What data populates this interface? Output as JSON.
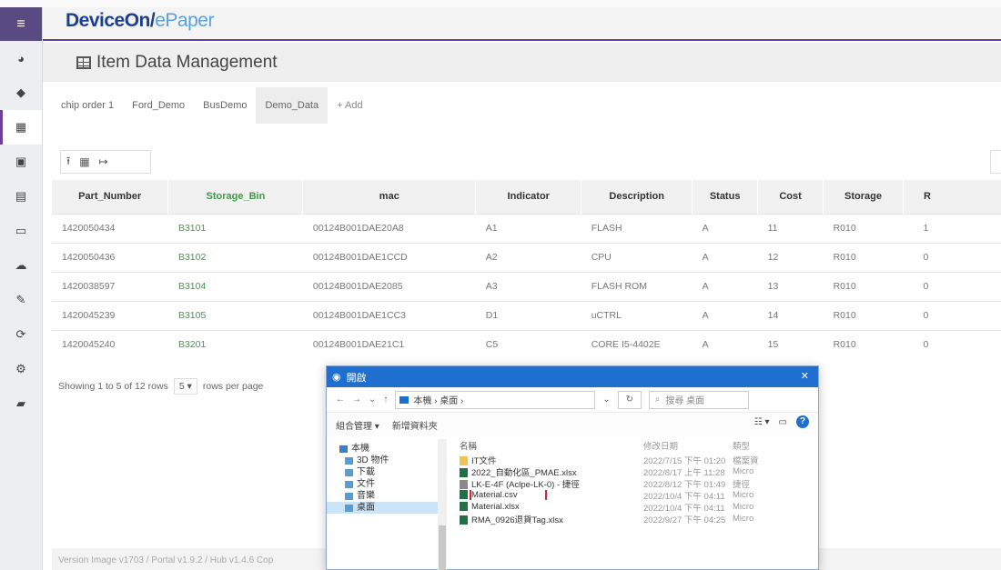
{
  "app": {
    "brand_main": "DeviceOn/",
    "brand_accent": "ePaper",
    "brand_color": "#1d3f8f",
    "accent_color": "#6a3f95"
  },
  "sidebar": {
    "items": [
      {
        "icon": "menu-icon",
        "glyph": "≡"
      },
      {
        "icon": "dashboard-icon",
        "glyph": "◕"
      },
      {
        "icon": "tag-icon",
        "glyph": "◆"
      },
      {
        "icon": "table-icon",
        "glyph": "▦"
      },
      {
        "icon": "image-icon",
        "glyph": "▣"
      },
      {
        "icon": "template-icon",
        "glyph": "▤"
      },
      {
        "icon": "monitor-icon",
        "glyph": "▭"
      },
      {
        "icon": "cloud-icon",
        "glyph": "☁"
      },
      {
        "icon": "edit-icon",
        "glyph": "✎"
      },
      {
        "icon": "sync-icon",
        "glyph": "⟳"
      },
      {
        "icon": "settings-icon",
        "glyph": "⚙"
      },
      {
        "icon": "book-icon",
        "glyph": "▰"
      }
    ]
  },
  "page": {
    "title": "Item Data Management"
  },
  "tabs": [
    {
      "label": "chip order 1"
    },
    {
      "label": "Ford_Demo"
    },
    {
      "label": "BusDemo"
    },
    {
      "label": "Demo_Data"
    },
    {
      "label": "+ Add"
    }
  ],
  "table": {
    "columns": [
      "Part_Number",
      "Storage_Bin",
      "mac",
      "Indicator",
      "Description",
      "Status",
      "Cost",
      "Storage",
      "R"
    ],
    "rows": [
      [
        "1420050434",
        "B3101",
        "00124B001DAE20A8",
        "A1",
        "FLASH",
        "A",
        "11",
        "R010",
        "1"
      ],
      [
        "1420050436",
        "B3102",
        "00124B001DAE1CCD",
        "A2",
        "CPU",
        "A",
        "12",
        "R010",
        "0"
      ],
      [
        "1420038597",
        "B3104",
        "00124B001DAE2085",
        "A3",
        "FLASH ROM",
        "A",
        "13",
        "R010",
        "0"
      ],
      [
        "1420045239",
        "B3105",
        "00124B001DAE1CC3",
        "D1",
        "uCTRL",
        "A",
        "14",
        "R010",
        "0"
      ],
      [
        "1420045240",
        "B3201",
        "00124B001DAE21C1",
        "C5",
        "CORE I5-4402E",
        "A",
        "15",
        "R010",
        "0"
      ]
    ]
  },
  "pagination": {
    "showing": "Showing 1 to 5 of 12 rows",
    "page_size": "5 ▾",
    "per_page_label": "rows per page"
  },
  "footer": {
    "version": "Version Image v1703 / Portal v1.9.2 / Hub v1.4.6 Cop"
  },
  "dialog": {
    "title": "開啟",
    "address": "本機 › 桌面 ›",
    "search_placeholder": "搜尋 桌面",
    "organize": "組合管理 ▾",
    "new_folder": "新增資料夾",
    "nav_items": [
      {
        "label": "本機",
        "sub": false,
        "selected": false
      },
      {
        "label": "3D 物件",
        "sub": true,
        "selected": false
      },
      {
        "label": "下載",
        "sub": true,
        "selected": false
      },
      {
        "label": "文件",
        "sub": true,
        "selected": false
      },
      {
        "label": "音樂",
        "sub": true,
        "selected": false
      },
      {
        "label": "桌面",
        "sub": true,
        "selected": true
      }
    ],
    "col_name": "名稱",
    "col_date": "修改日期",
    "col_type": "類型",
    "files": [
      {
        "name": "IT文件",
        "date": "2022/7/15 下午 01:20",
        "type": "檔案資",
        "kind": "folder",
        "highlight": false
      },
      {
        "name": "2022_自動化區_PMAE.xlsx",
        "date": "2022/8/17 上午 11:28",
        "type": "Micro",
        "kind": "excel",
        "highlight": false
      },
      {
        "name": "LK-E-4F (Aclpe-LK-0) - 捷徑",
        "date": "2022/8/12 下午 01:49",
        "type": "捷徑",
        "kind": "shortcut",
        "highlight": false
      },
      {
        "name": "Material.csv",
        "date": "2022/10/4 下午 04:11",
        "type": "Micro",
        "kind": "excel",
        "highlight": true
      },
      {
        "name": "Material.xlsx",
        "date": "2022/10/4 下午 04:11",
        "type": "Micro",
        "kind": "excel",
        "highlight": false
      },
      {
        "name": "RMA_0926退貨Tag.xlsx",
        "date": "2022/9/27 下午 04:25",
        "type": "Micro",
        "kind": "excel",
        "highlight": false
      }
    ]
  }
}
